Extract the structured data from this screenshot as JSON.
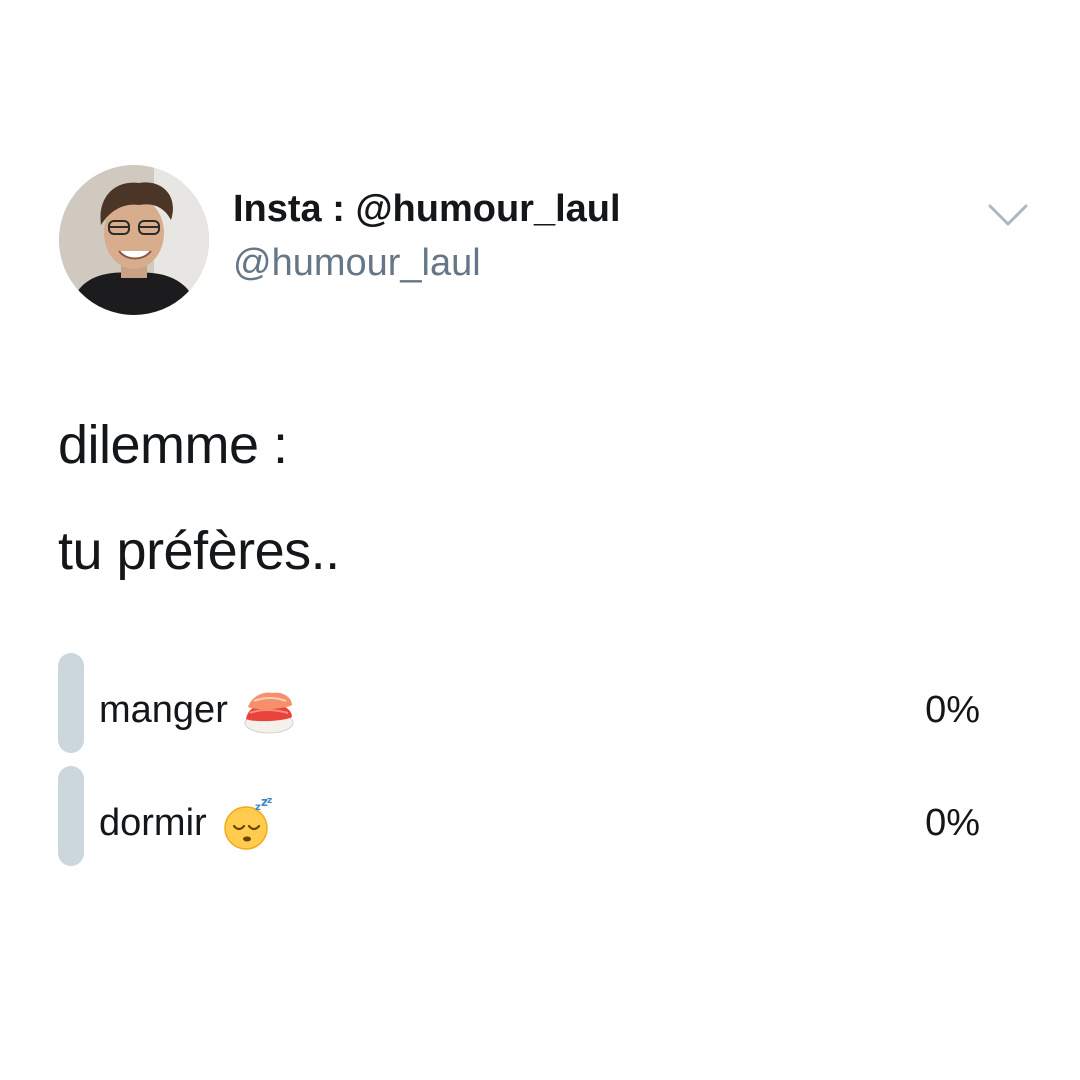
{
  "author": {
    "display_name": "Insta : @humour_laul",
    "handle": "@humour_laul",
    "avatar_icon": "profile-photo"
  },
  "menu": {
    "icon": "chevron-down-icon"
  },
  "tweet": {
    "lines": [
      "dilemme :",
      "tu préfères.."
    ]
  },
  "poll": {
    "options": [
      {
        "label": "manger",
        "emoji": "sushi",
        "percent_text": "0%",
        "percent": 0
      },
      {
        "label": "dormir",
        "emoji": "sleeping-face",
        "percent_text": "0%",
        "percent": 0
      }
    ],
    "bar_color": "#ccd6dd"
  },
  "colors": {
    "text": "#14171a",
    "secondary_text": "#657786",
    "background": "#ffffff"
  }
}
